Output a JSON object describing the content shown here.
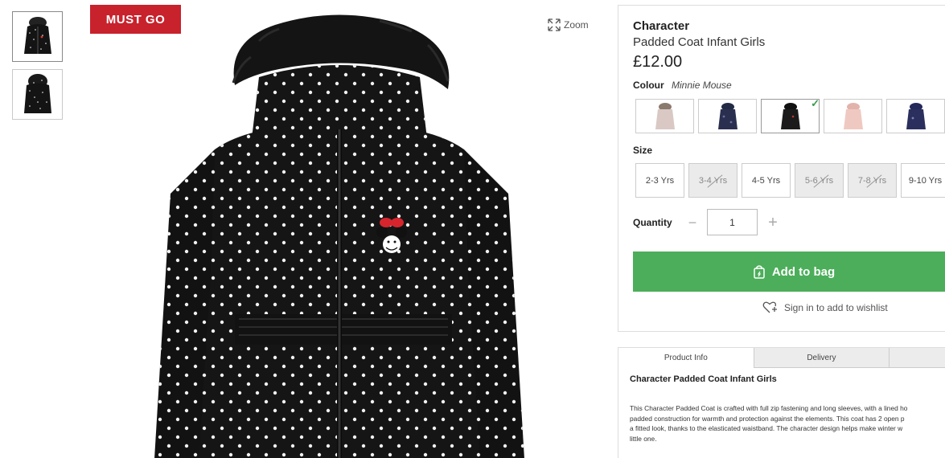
{
  "badge": "MUST GO",
  "zoom_label": "Zoom",
  "thumbnails": [
    {
      "icon": "coat-front-thumbnail"
    },
    {
      "icon": "coat-back-thumbnail"
    }
  ],
  "product": {
    "brand": "Character",
    "name": "Padded Coat Infant Girls",
    "price": "£12.00"
  },
  "colour": {
    "label": "Colour",
    "value": "Minnie Mouse",
    "swatches": [
      {
        "colour": "#d9c8c4"
      },
      {
        "colour": "#2a2f4f"
      },
      {
        "colour": "#1b1b1b",
        "selected": true
      },
      {
        "colour": "#efc9c1"
      },
      {
        "colour": "#2b2f5e"
      }
    ]
  },
  "size": {
    "label": "Size",
    "options": [
      {
        "label": "2-3 Yrs",
        "available": true
      },
      {
        "label": "3-4 Yrs",
        "available": false
      },
      {
        "label": "4-5 Yrs",
        "available": true
      },
      {
        "label": "5-6 Yrs",
        "available": false
      },
      {
        "label": "7-8 Yrs",
        "available": false
      },
      {
        "label": "9-10 Yrs",
        "available": true
      }
    ]
  },
  "quantity": {
    "label": "Quantity",
    "value": "1",
    "minus": "−",
    "plus": "+"
  },
  "add_to_bag": "Add to bag",
  "wishlist": "Sign in to add to wishlist",
  "info": {
    "tabs": [
      "Product Info",
      "Delivery",
      ""
    ],
    "title": "Character Padded Coat Infant Girls",
    "description_lines": [
      "This Character Padded Coat is crafted with full zip fastening and long sleeves, with a lined ho",
      "padded construction for warmth and protection against the elements. This coat has 2 open p",
      "a fitted look, thanks to the elasticated waistband. The character design helps make winter w",
      "little one."
    ]
  },
  "colors": {
    "badge_red": "#c8222c",
    "add_bag_green": "#4cae5a",
    "check_green": "#3a9b4b"
  }
}
